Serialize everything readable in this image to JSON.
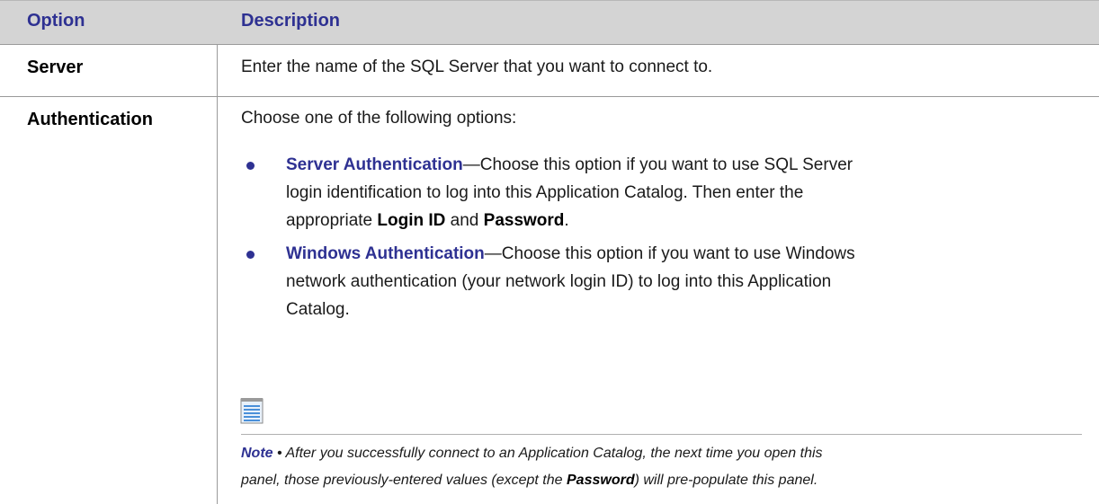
{
  "header": {
    "option": "Option",
    "description": "Description"
  },
  "rows": [
    {
      "option": "Server",
      "description": "Enter the name of the SQL Server that you want to connect to."
    },
    {
      "option": "Authentication",
      "intro": "Choose one of the following options:"
    }
  ],
  "bullets": [
    {
      "term": "Server Authentication",
      "dash": "—",
      "text1": "Choose this option if you want to use SQL Server",
      "text2": "login identification to log into this Application Catalog. Then enter the",
      "text3a": "appropriate ",
      "bold1": "Login ID",
      "text3b": " and ",
      "bold2": "Password",
      "text3c": "."
    },
    {
      "term": "Windows Authentication",
      "dash": "—",
      "text1": "Choose this option if you want to use Windows",
      "text2": "network authentication (your network login ID) to log into this Application",
      "text3": "Catalog."
    }
  ],
  "note": {
    "label": "Note",
    "sep": " • ",
    "line1": "After you successfully connect to an Application Catalog, the next time you open this",
    "line2a": "panel, those previously-entered values (except the ",
    "bold": "Password",
    "line2b": ") will pre-populate this panel."
  },
  "colors": {
    "heading_blue": "#2e3192",
    "header_bg": "#d4d4d4",
    "note_icon": "#4a90d9"
  },
  "icons": {
    "note": "notepad-icon"
  }
}
